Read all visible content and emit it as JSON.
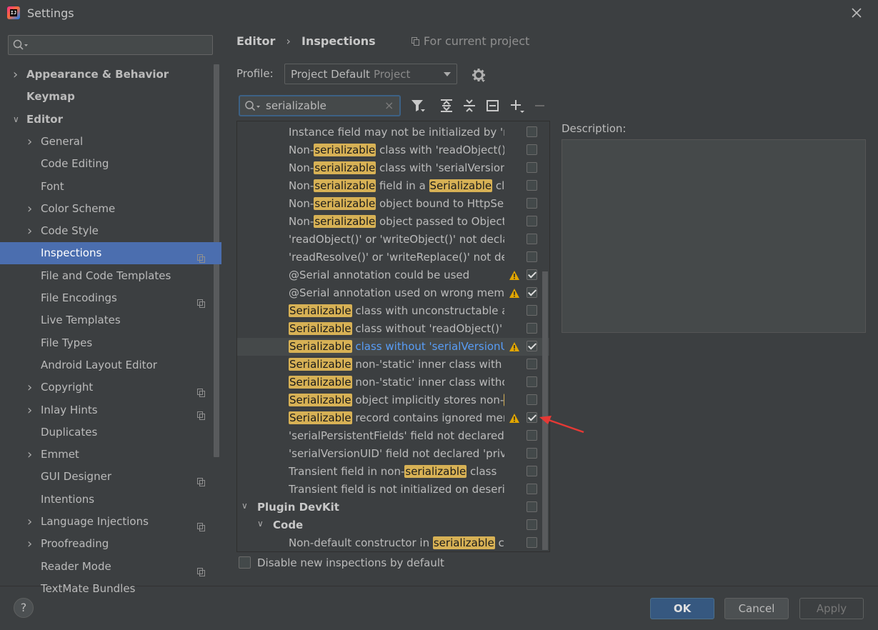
{
  "window": {
    "title": "Settings",
    "app_icon_text": "IJ"
  },
  "sidebar": {
    "search_value": "",
    "items": [
      {
        "label": "Appearance & Behavior",
        "level": 0,
        "expander": "collapsed",
        "bold": true
      },
      {
        "label": "Keymap",
        "level": 0,
        "expander": "none",
        "bold": true
      },
      {
        "label": "Editor",
        "level": 0,
        "expander": "expanded",
        "bold": true
      },
      {
        "label": "General",
        "level": 1,
        "expander": "collapsed"
      },
      {
        "label": "Code Editing",
        "level": 1,
        "expander": "none"
      },
      {
        "label": "Font",
        "level": 1,
        "expander": "none"
      },
      {
        "label": "Color Scheme",
        "level": 1,
        "expander": "collapsed"
      },
      {
        "label": "Code Style",
        "level": 1,
        "expander": "collapsed"
      },
      {
        "label": "Inspections",
        "level": 1,
        "expander": "none",
        "selected": true,
        "project_icon": true
      },
      {
        "label": "File and Code Templates",
        "level": 1,
        "expander": "none"
      },
      {
        "label": "File Encodings",
        "level": 1,
        "expander": "none",
        "project_icon": true
      },
      {
        "label": "Live Templates",
        "level": 1,
        "expander": "none"
      },
      {
        "label": "File Types",
        "level": 1,
        "expander": "none"
      },
      {
        "label": "Android Layout Editor",
        "level": 1,
        "expander": "none"
      },
      {
        "label": "Copyright",
        "level": 1,
        "expander": "collapsed",
        "project_icon": true
      },
      {
        "label": "Inlay Hints",
        "level": 1,
        "expander": "collapsed",
        "project_icon": true
      },
      {
        "label": "Duplicates",
        "level": 1,
        "expander": "none"
      },
      {
        "label": "Emmet",
        "level": 1,
        "expander": "collapsed"
      },
      {
        "label": "GUI Designer",
        "level": 1,
        "expander": "none",
        "project_icon": true
      },
      {
        "label": "Intentions",
        "level": 1,
        "expander": "none"
      },
      {
        "label": "Language Injections",
        "level": 1,
        "expander": "collapsed",
        "project_icon": true
      },
      {
        "label": "Proofreading",
        "level": 1,
        "expander": "collapsed"
      },
      {
        "label": "Reader Mode",
        "level": 1,
        "expander": "none",
        "project_icon": true
      },
      {
        "label": "TextMate Bundles",
        "level": 1,
        "expander": "none"
      }
    ]
  },
  "breadcrumb": {
    "parent": "Editor",
    "separator": "›",
    "current": "Inspections",
    "scope": "For current project"
  },
  "profile": {
    "label": "Profile:",
    "value": "Project Default",
    "scope": "Project"
  },
  "filter": {
    "value": "serializable",
    "clear_glyph": "×"
  },
  "inspections": [
    {
      "parts": [
        "Instance field may not be initialized by 're"
      ],
      "warn": false,
      "checked": false
    },
    {
      "parts": [
        "Non-",
        "serializable",
        " class with 'readObject()' o"
      ],
      "warn": false,
      "checked": false
    },
    {
      "parts": [
        "Non-",
        "serializable",
        " class with 'serialVersionU"
      ],
      "warn": false,
      "checked": false
    },
    {
      "parts": [
        "Non-",
        "serializable",
        " field in a ",
        "Serializable",
        " class"
      ],
      "warn": false,
      "checked": false
    },
    {
      "parts": [
        "Non-",
        "serializable",
        " object bound to HttpSes"
      ],
      "warn": false,
      "checked": false
    },
    {
      "parts": [
        "Non-",
        "serializable",
        " object passed to ObjectO"
      ],
      "warn": false,
      "checked": false
    },
    {
      "parts": [
        "'readObject()' or 'writeObject()' not decla"
      ],
      "warn": false,
      "checked": false
    },
    {
      "parts": [
        "'readResolve()' or 'writeReplace()' not dec"
      ],
      "warn": false,
      "checked": false
    },
    {
      "parts": [
        "@Serial annotation could be used"
      ],
      "warn": true,
      "checked": true
    },
    {
      "parts": [
        "@Serial annotation used on wrong memb"
      ],
      "warn": true,
      "checked": true
    },
    {
      "parts": [
        "",
        "Serializable",
        " class with unconstructable and"
      ],
      "warn": false,
      "checked": false
    },
    {
      "parts": [
        "",
        "Serializable",
        " class without 'readObject()' ar"
      ],
      "warn": false,
      "checked": false
    },
    {
      "parts": [
        "",
        "Serializable",
        " class without 'serialVersionUID"
      ],
      "warn": true,
      "checked": true,
      "highlighted": true
    },
    {
      "parts": [
        "",
        "Serializable",
        " non-'static' inner class with no"
      ],
      "warn": false,
      "checked": false
    },
    {
      "parts": [
        "",
        "Serializable",
        " non-'static' inner class withou"
      ],
      "warn": false,
      "checked": false
    },
    {
      "parts": [
        "",
        "Serializable",
        " object implicitly stores non-",
        "Se"
      ],
      "warn": false,
      "checked": false
    },
    {
      "parts": [
        "",
        "Serializable",
        " record contains ignored mem"
      ],
      "warn": true,
      "checked": true
    },
    {
      "parts": [
        "'serialPersistentFields' field not declared '"
      ],
      "warn": false,
      "checked": false
    },
    {
      "parts": [
        "'serialVersionUID' field not declared 'priva"
      ],
      "warn": false,
      "checked": false
    },
    {
      "parts": [
        "Transient field in non-",
        "serializable",
        " class"
      ],
      "warn": false,
      "checked": false
    },
    {
      "parts": [
        "Transient field is not initialized on deseria"
      ],
      "warn": false,
      "checked": false
    },
    {
      "group": "Plugin DevKit",
      "level": 0,
      "checked": false
    },
    {
      "group": "Code",
      "level": 1,
      "checked": false
    },
    {
      "parts": [
        "Non-default constructor in ",
        "serializable",
        " cla"
      ],
      "warn": false,
      "checked": false
    }
  ],
  "description": {
    "label": "Description:"
  },
  "disable_new": {
    "label": "Disable new inspections by default",
    "checked": false
  },
  "buttons": {
    "help": "?",
    "ok": "OK",
    "cancel": "Cancel",
    "apply": "Apply"
  },
  "colors": {
    "accent": "#4b6eaf",
    "match_highlight": "#d7b155",
    "link": "#589df6",
    "warning": "#e2a600",
    "annotation_arrow": "#e53935"
  }
}
